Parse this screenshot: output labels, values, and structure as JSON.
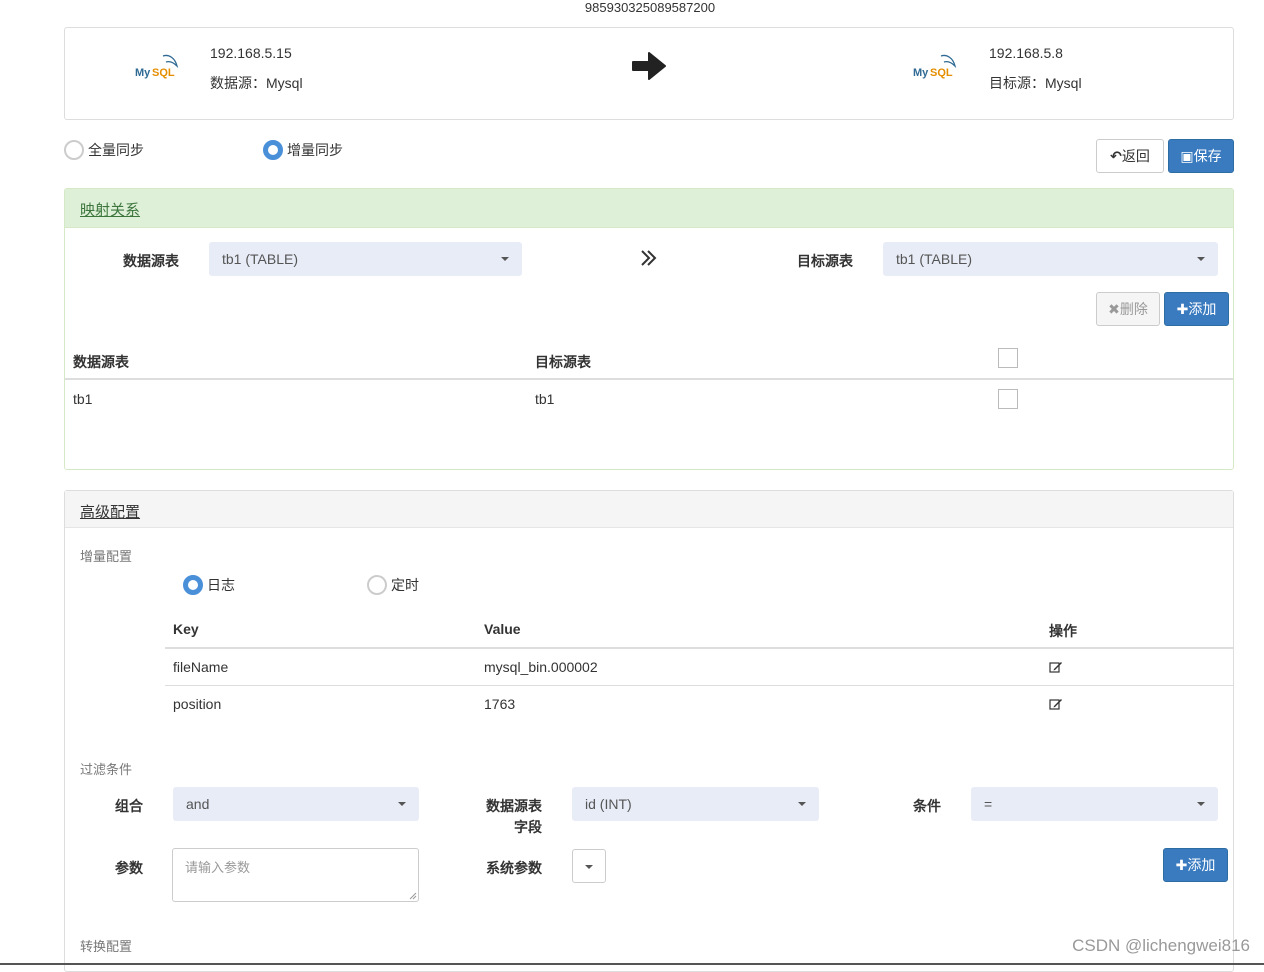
{
  "task_id": "985930325089587200",
  "source": {
    "ip": "192.168.5.15",
    "type_label": "数据源：Mysql",
    "logo_text": "MySQL"
  },
  "target": {
    "ip": "192.168.5.8",
    "type_label": "目标源：Mysql",
    "logo_text": "MySQL"
  },
  "sync_mode": {
    "full_label": "全量同步",
    "incremental_label": "增量同步",
    "selected": "incremental"
  },
  "actions": {
    "back_label": "返回",
    "save_label": "保存"
  },
  "mapping": {
    "title": "映射关系",
    "source_table_label": "数据源表",
    "source_table_value": "tb1 (TABLE)",
    "target_table_label": "目标源表",
    "target_table_value": "tb1 (TABLE)",
    "delete_label": "删除",
    "add_label": "添加",
    "table": {
      "headers": [
        "数据源表",
        "目标源表"
      ],
      "rows": [
        {
          "source": "tb1",
          "target": "tb1"
        }
      ]
    }
  },
  "advanced": {
    "title": "高级配置",
    "incremental_label": "增量配置",
    "mode_log_label": "日志",
    "mode_timer_label": "定时",
    "mode_selected": "log",
    "kv_table": {
      "headers": {
        "key": "Key",
        "value": "Value",
        "op": "操作"
      },
      "rows": [
        {
          "key": "fileName",
          "value": "mysql_bin.000002"
        },
        {
          "key": "position",
          "value": "1763"
        }
      ]
    },
    "filter": {
      "label": "过滤条件",
      "combine_label": "组合",
      "combine_value": "and",
      "field_label_1": "数据源表",
      "field_label_2": "字段",
      "field_value": "id (INT)",
      "condition_label": "条件",
      "condition_value": "=",
      "param_label": "参数",
      "param_placeholder": "请输入参数",
      "sys_param_label": "系统参数",
      "add_label": "添加"
    },
    "transform_label": "转换配置"
  },
  "watermark": "CSDN @lichengwei816",
  "colors": {
    "primary": "#3a7bc0",
    "panel_green": "#dff0d8",
    "select_bg": "#e8ecf7",
    "radio_on": "#4a90d9"
  }
}
